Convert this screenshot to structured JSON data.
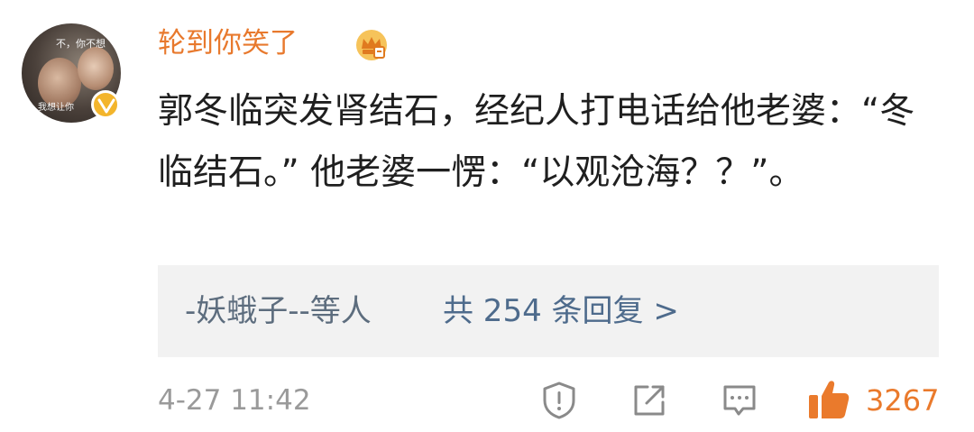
{
  "comment": {
    "username": "轮到你笑了",
    "avatar_text_top": "不，你不想",
    "avatar_text_bottom": "我想让你",
    "content": "郭冬临突发肾结石，经纪人打电话给他老婆：“冬临结石。” 他老婆一愣：“以观沧海？？”。",
    "reply_users": "-妖蛾子--等人",
    "reply_count_label": "共 254 条回复 >",
    "timestamp": "4-27 11:42",
    "like_count": "3267"
  },
  "icons": {
    "badge": "crown-badge-icon",
    "verified": "verified-v-icon",
    "report": "report-warning-icon",
    "share": "share-arrow-icon",
    "comment": "comment-bubble-icon",
    "like": "thumbs-up-icon"
  },
  "colors": {
    "username": "#e8792d",
    "reply_link": "#4e6b8c",
    "like": "#ea7a2c",
    "muted": "#9a9a9a",
    "reply_bg": "#f2f2f2"
  }
}
